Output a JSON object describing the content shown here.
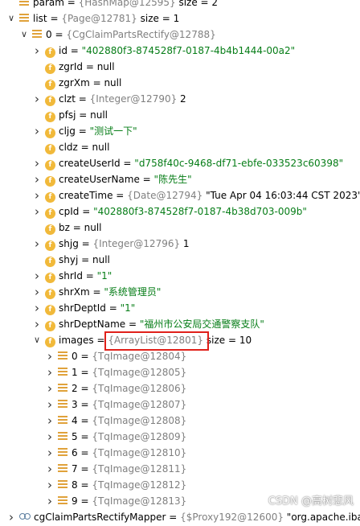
{
  "rows": [
    {
      "key": "param",
      "eq": " = ",
      "ref": "{HashMap@12595}",
      "tail": " size = 2",
      "indent": 0,
      "icon": "list"
    },
    {
      "key": "list",
      "eq": " = ",
      "ref": "{Page@12781}",
      "tail": " size = 1",
      "indent": 0,
      "icon": "list",
      "expanded": true
    },
    {
      "key": "0",
      "eq": " = ",
      "ref": "{CgClaimPartsRectify@12788}",
      "tail": "",
      "indent": 1,
      "icon": "list",
      "expanded": true
    },
    {
      "key": "id",
      "eq": " = ",
      "str": "\"402880f3-874528f7-0187-4b4b1444-00a2\"",
      "indent": 2,
      "icon": "f",
      "collapsed": true
    },
    {
      "key": "zgrId",
      "eq": " = ",
      "tail": "null",
      "indent": 2,
      "icon": "f"
    },
    {
      "key": "zgrXm",
      "eq": " = ",
      "tail": "null",
      "indent": 2,
      "icon": "f"
    },
    {
      "key": "clzt",
      "eq": " = ",
      "ref": "{Integer@12790}",
      "tail": " 2",
      "indent": 2,
      "icon": "f",
      "collapsed": true
    },
    {
      "key": "pfsj",
      "eq": " = ",
      "tail": "null",
      "indent": 2,
      "icon": "f"
    },
    {
      "key": "cljg",
      "eq": " = ",
      "str": "\"测试一下\"",
      "indent": 2,
      "icon": "f",
      "collapsed": true
    },
    {
      "key": "cldz",
      "eq": " = ",
      "tail": "null",
      "indent": 2,
      "icon": "f"
    },
    {
      "key": "createUserId",
      "eq": " = ",
      "str": "\"d758f40c-9468-df71-ebfe-033523c60398\"",
      "indent": 2,
      "icon": "f",
      "collapsed": true
    },
    {
      "key": "createUserName",
      "eq": " = ",
      "str": "\"陈先生\"",
      "indent": 2,
      "icon": "f",
      "collapsed": true
    },
    {
      "key": "createTime",
      "eq": " = ",
      "ref": "{Date@12794}",
      "tail": " \"Tue Apr 04 16:03:44 CST 2023\"",
      "indent": 2,
      "icon": "f",
      "collapsed": true
    },
    {
      "key": "cpId",
      "eq": " = ",
      "str": "\"402880f3-874528f7-0187-4b38d703-009b\"",
      "indent": 2,
      "icon": "f",
      "collapsed": true
    },
    {
      "key": "bz",
      "eq": " = ",
      "tail": "null",
      "indent": 2,
      "icon": "f"
    },
    {
      "key": "shjg",
      "eq": " = ",
      "ref": "{Integer@12796}",
      "tail": " 1",
      "indent": 2,
      "icon": "f",
      "collapsed": true
    },
    {
      "key": "shyj",
      "eq": " = ",
      "tail": "null",
      "indent": 2,
      "icon": "f"
    },
    {
      "key": "shrId",
      "eq": " = ",
      "str": "\"1\"",
      "indent": 2,
      "icon": "f",
      "collapsed": true
    },
    {
      "key": "shrXm",
      "eq": " = ",
      "str": "\"系统管理员\"",
      "indent": 2,
      "icon": "f",
      "collapsed": true
    },
    {
      "key": "shrDeptId",
      "eq": " = ",
      "str": "\"1\"",
      "indent": 2,
      "icon": "f",
      "collapsed": true
    },
    {
      "key": "shrDeptName",
      "eq": " = ",
      "str": "\"福州市公安局交通警察支队\"",
      "indent": 2,
      "icon": "f",
      "collapsed": true
    },
    {
      "key": "images",
      "eq": " = ",
      "ref": "{ArrayList@12801}",
      "tail": " size = 10",
      "indent": 2,
      "icon": "f",
      "expanded": true
    },
    {
      "key": "0",
      "eq": " = ",
      "ref": "{TqImage@12804}",
      "indent": 3,
      "icon": "list",
      "collapsed": true
    },
    {
      "key": "1",
      "eq": " = ",
      "ref": "{TqImage@12805}",
      "indent": 3,
      "icon": "list",
      "collapsed": true
    },
    {
      "key": "2",
      "eq": " = ",
      "ref": "{TqImage@12806}",
      "indent": 3,
      "icon": "list",
      "collapsed": true
    },
    {
      "key": "3",
      "eq": " = ",
      "ref": "{TqImage@12807}",
      "indent": 3,
      "icon": "list",
      "collapsed": true
    },
    {
      "key": "4",
      "eq": " = ",
      "ref": "{TqImage@12808}",
      "indent": 3,
      "icon": "list",
      "collapsed": true
    },
    {
      "key": "5",
      "eq": " = ",
      "ref": "{TqImage@12809}",
      "indent": 3,
      "icon": "list",
      "collapsed": true
    },
    {
      "key": "6",
      "eq": " = ",
      "ref": "{TqImage@12810}",
      "indent": 3,
      "icon": "list",
      "collapsed": true
    },
    {
      "key": "7",
      "eq": " = ",
      "ref": "{TqImage@12811}",
      "indent": 3,
      "icon": "list",
      "collapsed": true
    },
    {
      "key": "8",
      "eq": " = ",
      "ref": "{TqImage@12812}",
      "indent": 3,
      "icon": "list",
      "collapsed": true
    },
    {
      "key": "9",
      "eq": " = ",
      "ref": "{TqImage@12813}",
      "indent": 3,
      "icon": "list",
      "collapsed": true
    },
    {
      "key": "cgClaimPartsRectifyMapper",
      "eq": " = ",
      "ref": "{$Proxy192@12600}",
      "tail": " \"org.apache.ibatis",
      "indent": 0,
      "icon": "oo",
      "collapsed": true
    }
  ],
  "watermark": "CSDN @高树悲风",
  "colors": {
    "string": "#067d17",
    "ref": "#808080",
    "highlight": "#e0201a"
  }
}
